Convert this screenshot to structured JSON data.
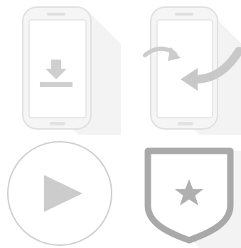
{
  "icons": [
    {
      "id": "download-to-phone",
      "name": "phone-download-icon",
      "color": "#cccccc"
    },
    {
      "id": "transfer-to-phone",
      "name": "phone-transfer-icon",
      "color": "#cccccc"
    },
    {
      "id": "play",
      "name": "play-button-icon",
      "color": "#c8c8c8"
    },
    {
      "id": "badge",
      "name": "shield-star-icon",
      "color": "#aaaaaa"
    }
  ],
  "colors": {
    "background": "#ffffff",
    "phone_body": "#f4f4f4",
    "phone_outline": "#dcdcdc",
    "glyph": "#cfcfcf",
    "shadow": "#ededed"
  }
}
